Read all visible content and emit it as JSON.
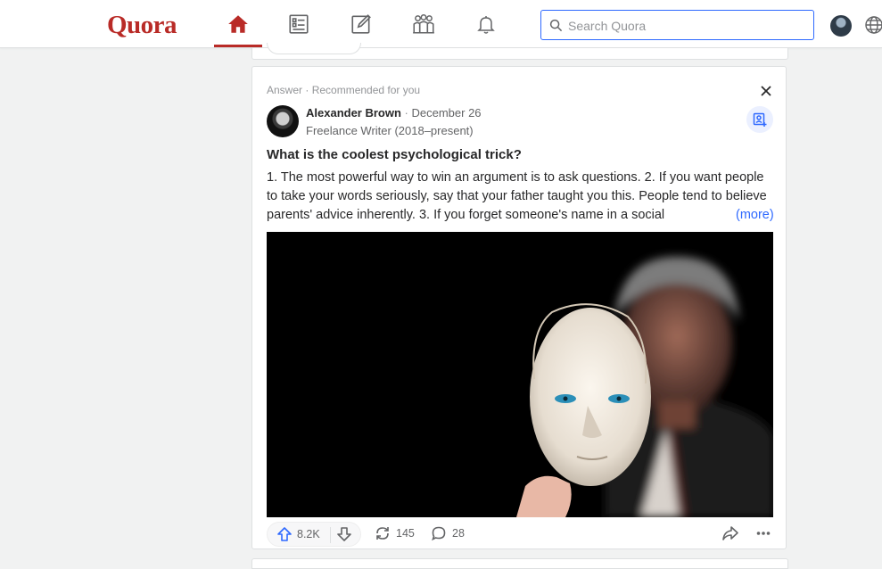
{
  "header": {
    "logo": "Quora",
    "nav": [
      {
        "name": "home",
        "active": true
      },
      {
        "name": "following"
      },
      {
        "name": "answer"
      },
      {
        "name": "spaces"
      },
      {
        "name": "notifications"
      }
    ],
    "search": {
      "placeholder": "Search Quora",
      "value": ""
    },
    "icons": [
      "home-icon",
      "following-icon",
      "answer-icon",
      "spaces-icon",
      "bell-icon",
      "search-icon",
      "globe-icon"
    ],
    "accent_color": "#b92b27",
    "focus_color": "#2e69ff"
  },
  "post": {
    "type": "Answer",
    "reason": "Recommended for you",
    "author": {
      "name": "Alexander Brown",
      "date": "December 26",
      "credential": "Freelance Writer (2018–present)"
    },
    "question": "What is the coolest psychological trick?",
    "body": "1. The most powerful way to win an argument is to ask questions. 2. If you want people to take your words seriously, say that your father taught you this. People tend to believe parents' advice inherently. 3. If you forget someone's name in a social",
    "more_label": "(more)",
    "image_description_icon": "mask-man-image",
    "upvotes": "8.2K",
    "shares": "145",
    "comments": "28"
  }
}
